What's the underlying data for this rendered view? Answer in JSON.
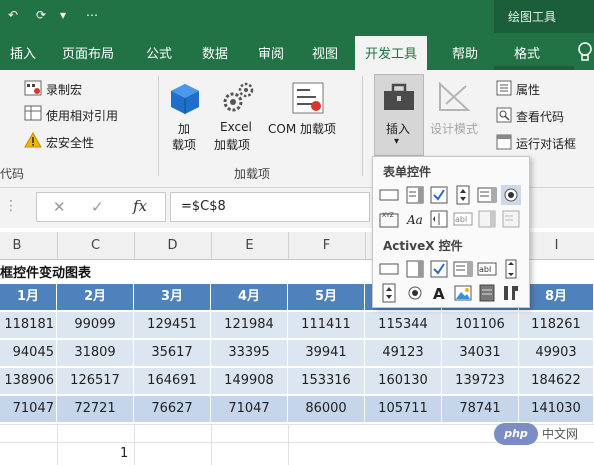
{
  "titlebar": {
    "drawing_tools": "绘图工具",
    "quick_access": [
      "↶",
      "⟳",
      "▾",
      "⋯"
    ]
  },
  "tabs": [
    {
      "label": "插入"
    },
    {
      "label": "页面布局"
    },
    {
      "label": "公式"
    },
    {
      "label": "数据"
    },
    {
      "label": "审阅"
    },
    {
      "label": "视图"
    },
    {
      "label": "开发工具",
      "active": true
    },
    {
      "label": "帮助"
    },
    {
      "label": "格式"
    }
  ],
  "ribbon": {
    "code_group": {
      "record_macro": "录制宏",
      "relative_ref": "使用相对引用",
      "macro_security": "宏安全性",
      "group_label": "代码"
    },
    "addins_group": {
      "addins_line1": "加",
      "addins_line2": "载项",
      "excel_addins_line1": "Excel",
      "excel_addins_line2": "加载项",
      "com_addins": "COM 加载项",
      "group_label": "加载项"
    },
    "controls_group": {
      "insert": "插入",
      "design_mode": "设计模式",
      "properties": "属性",
      "view_code": "查看代码",
      "run_dialog": "运行对话框"
    }
  },
  "formula_bar": {
    "cancel_symbol": "✕",
    "enter_symbol": "✓",
    "fx_symbol": "fx",
    "formula": "=$C$8"
  },
  "columns": [
    "B",
    "C",
    "D",
    "E",
    "F",
    "G",
    "H",
    "I"
  ],
  "sheet": {
    "title": "框控件变动图表",
    "headers": [
      "1月",
      "2月",
      "3月",
      "4月",
      "5月",
      "6月",
      "7月",
      "8月"
    ],
    "rows": [
      [
        "118181",
        "99099",
        "129451",
        "121984",
        "111411",
        "115344",
        "101106",
        "118261"
      ],
      [
        "94045",
        "31809",
        "35617",
        "33395",
        "39941",
        "49123",
        "34031",
        "49903"
      ],
      [
        "138906",
        "126517",
        "164691",
        "149908",
        "153316",
        "160130",
        "139723",
        "184622"
      ],
      [
        "71047",
        "72721",
        "76627",
        "71047",
        "86000",
        "105711",
        "78741",
        "141030"
      ]
    ],
    "linked_cell_value": "1"
  },
  "dropdown": {
    "form_controls_title": "表单控件",
    "activex_title": "ActiveX 控件"
  },
  "watermark": {
    "badge": "php",
    "site": "中文网"
  },
  "colors": {
    "excel_green": "#217346",
    "header_blue": "#4f81bd",
    "band_light": "#dce6f1",
    "band_dark": "#c5d6ea"
  }
}
